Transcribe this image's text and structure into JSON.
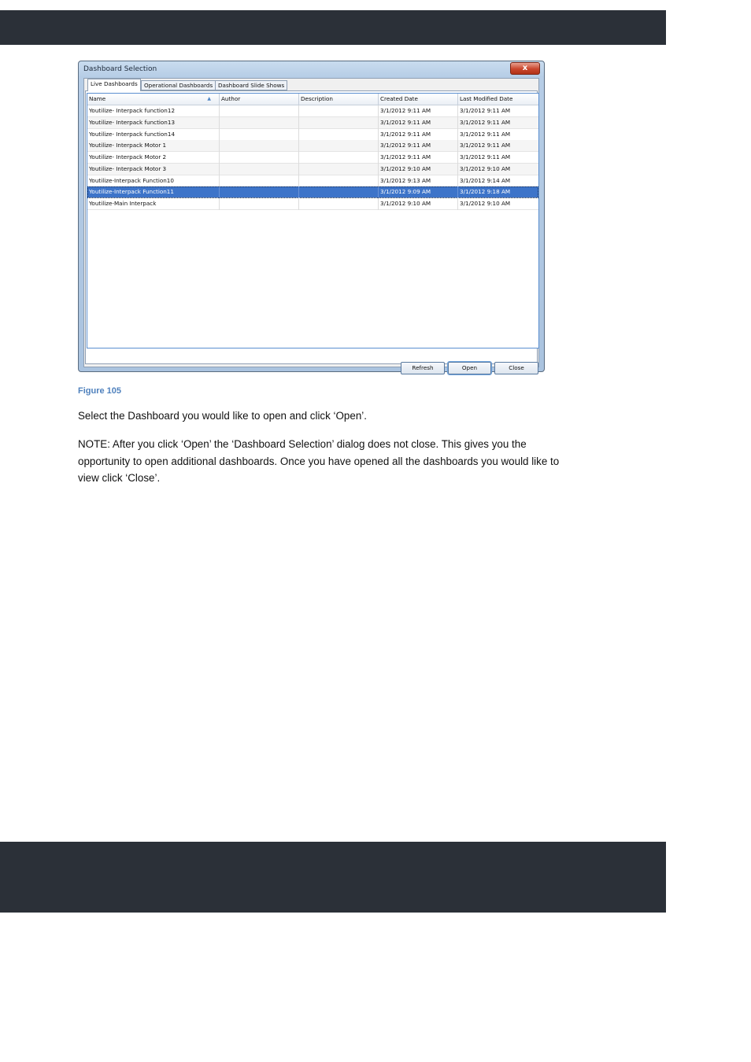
{
  "dialog": {
    "title": "Dashboard Selection",
    "close_glyph": "x",
    "tabs": [
      {
        "label": "Live Dashboards",
        "active": true
      },
      {
        "label": "Operational Dashboards",
        "active": false
      },
      {
        "label": "Dashboard Slide Shows",
        "active": false
      }
    ],
    "columns": [
      "Name",
      "Author",
      "Description",
      "Created Date",
      "Last Modified Date"
    ],
    "sort_indicator": "▲",
    "rows": [
      {
        "name": "Youtilize- Interpack function12",
        "author": "",
        "description": "",
        "created": "3/1/2012 9:11 AM",
        "modified": "3/1/2012 9:11 AM"
      },
      {
        "name": "Youtilize- Interpack function13",
        "author": "",
        "description": "",
        "created": "3/1/2012 9:11 AM",
        "modified": "3/1/2012 9:11 AM"
      },
      {
        "name": "Youtilize- Interpack function14",
        "author": "",
        "description": "",
        "created": "3/1/2012 9:11 AM",
        "modified": "3/1/2012 9:11 AM"
      },
      {
        "name": "Youtilize- Interpack Motor 1",
        "author": "",
        "description": "",
        "created": "3/1/2012 9:11 AM",
        "modified": "3/1/2012 9:11 AM"
      },
      {
        "name": "Youtilize- Interpack Motor 2",
        "author": "",
        "description": "",
        "created": "3/1/2012 9:11 AM",
        "modified": "3/1/2012 9:11 AM"
      },
      {
        "name": "Youtilize- Interpack Motor 3",
        "author": "",
        "description": "",
        "created": "3/1/2012 9:10 AM",
        "modified": "3/1/2012 9:10 AM"
      },
      {
        "name": "Youtilize-Interpack Function10",
        "author": "",
        "description": "",
        "created": "3/1/2012 9:13 AM",
        "modified": "3/1/2012 9:14 AM"
      },
      {
        "name": "Youtilize-Interpack Function11",
        "author": "",
        "description": "",
        "created": "3/1/2012 9:09 AM",
        "modified": "3/1/2012 9:18 AM",
        "selected": true
      },
      {
        "name": "Youtilize-Main Interpack",
        "author": "",
        "description": "",
        "created": "3/1/2012 9:10 AM",
        "modified": "3/1/2012 9:10 AM"
      }
    ],
    "buttons": {
      "refresh": "Refresh",
      "open": "Open",
      "close": "Close"
    }
  },
  "caption": "Figure 105",
  "paragraphs": [
    "Select the Dashboard you would like to open and click ‘Open’.",
    "NOTE:  After you click ‘Open’ the ‘Dashboard Selection’ dialog does not close.  This gives you the opportunity to open additional dashboards.  Once you have opened all the dashboards you would like to view click ‘Close’."
  ],
  "colors": {
    "band": "#2b3038",
    "selection": "#3d74c9",
    "caption": "#4f81bd"
  }
}
